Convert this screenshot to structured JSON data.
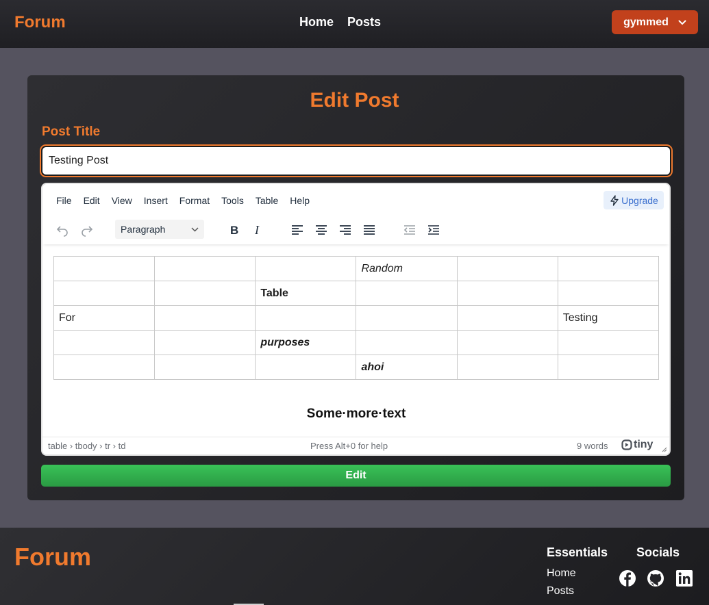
{
  "header": {
    "brand": "Forum",
    "nav": [
      "Home",
      "Posts"
    ],
    "user": "gymmed"
  },
  "page": {
    "title": "Edit Post",
    "field_label": "Post Title",
    "post_title_value": "Testing Post"
  },
  "editor": {
    "menu": [
      "File",
      "Edit",
      "View",
      "Insert",
      "Format",
      "Tools",
      "Table",
      "Help"
    ],
    "upgrade_label": "Upgrade",
    "block_format": "Paragraph",
    "table_rows": [
      [
        "",
        "",
        "",
        "Random",
        "",
        ""
      ],
      [
        "",
        "",
        "Table",
        "",
        "",
        ""
      ],
      [
        "For",
        "",
        "",
        "",
        "",
        "Testing"
      ],
      [
        "",
        "",
        "purposes",
        "",
        "",
        ""
      ],
      [
        "",
        "",
        "",
        "ahoi",
        "",
        ""
      ]
    ],
    "paragraph": "Some·more·text",
    "status_path": "table › tbody › tr › td",
    "status_help": "Press Alt+0 for help",
    "word_count": "9 words",
    "brand_logo": "tiny"
  },
  "submit_label": "Edit",
  "footer": {
    "brand": "Forum",
    "essentials_heading": "Essentials",
    "essentials_links": [
      "Home",
      "Posts"
    ],
    "socials_heading": "Socials",
    "social_icons": [
      "facebook-icon",
      "github-icon",
      "linkedin-icon"
    ]
  },
  "colors": {
    "accent": "#f07a2e",
    "user_button": "#c2411c",
    "edit_button": "#2fae4b",
    "background": "#55535f"
  }
}
